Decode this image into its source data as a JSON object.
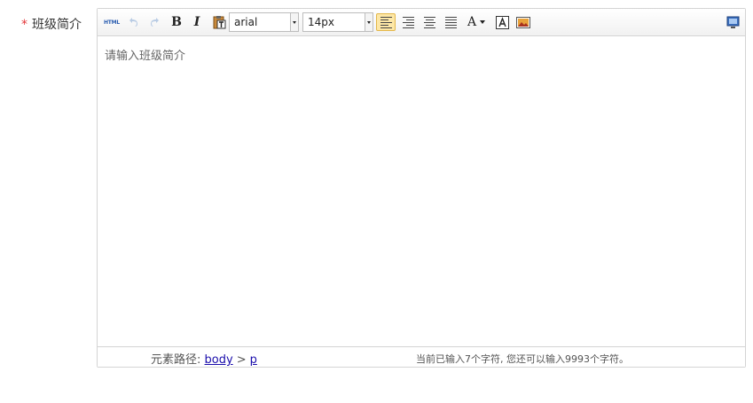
{
  "field": {
    "required_mark": "*",
    "label": "班级简介"
  },
  "toolbar": {
    "html_label": "HTML",
    "bold_label": "B",
    "italic_label": "I",
    "font_family": {
      "value": "arial"
    },
    "font_size": {
      "value": "14px"
    },
    "forecolor_label": "A",
    "icons": [
      "html-source-icon",
      "undo-icon",
      "redo-icon",
      "bold-icon",
      "italic-icon",
      "paste-plain-icon",
      "align-left-icon",
      "align-right-icon",
      "align-center-icon",
      "align-justify-icon",
      "font-color-icon",
      "background-color-icon",
      "insert-image-icon",
      "preview-icon"
    ],
    "active_accent": "#fde7a6"
  },
  "editor": {
    "placeholder": "请输入班级简介"
  },
  "statusbar": {
    "path_label": "元素路径:",
    "path": [
      "body",
      "p"
    ],
    "path_separator": ">",
    "char_count": "当前已输入7个字符, 您还可以输入9993个字符。"
  }
}
